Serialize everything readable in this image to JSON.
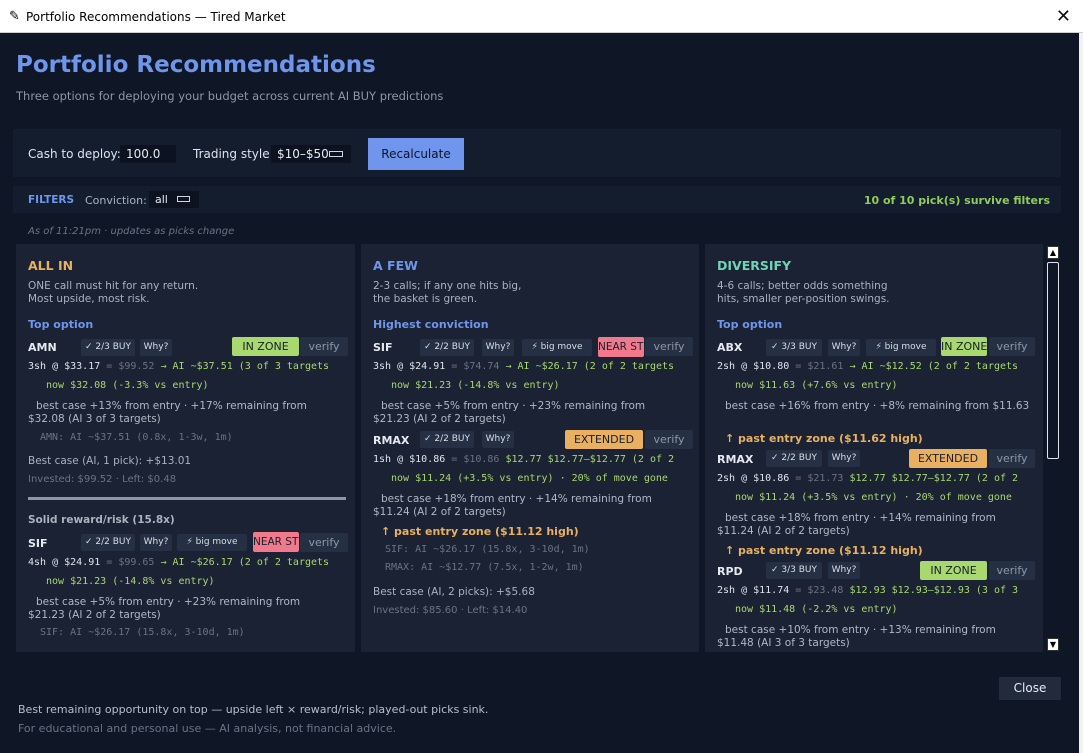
{
  "window": {
    "title": "Portfolio Recommendations — Tired Market"
  },
  "header": {
    "title": "Portfolio Recommendations",
    "subtitle": "Three options for deploying your budget across current AI BUY predictions"
  },
  "controls": {
    "cash_label": "Cash to deploy: $",
    "cash_value": "100.0",
    "style_label": "Trading style:",
    "style_value": "$10–$50",
    "recalc_label": "Recalculate"
  },
  "filters": {
    "label": "FILTERS",
    "conviction_label": "Conviction:",
    "conviction_value": "all",
    "survive_text": "10 of 10 pick(s) survive filters"
  },
  "as_of": "As of 11:21pm · updates as picks change",
  "allin": {
    "title": "ALL IN",
    "desc": "ONE call must hit for any return.\nMost upside, most risk.",
    "top_label": "Top option",
    "pick1": {
      "ticker": "AMN",
      "buy": "✓ 2/3 BUY",
      "why": "Why?",
      "status": "IN ZONE",
      "verify": "verify",
      "l1a": "3sh @ $33.17",
      "l1b": "= $99.52",
      "l1c": "→ AI ~$37.51  (3 of 3 targets",
      "l2a": "now $32.08  (-3.3% vs entry)",
      "best": "best case +13% from entry · +17% remaining from $32.08 (AI 3 of 3 targets)",
      "detail": "AMN: AI ~$37.51  (0.8x, 1-3w, 1m)"
    },
    "best_case": "Best case (AI, 1 pick): +$13.01",
    "invested": "Invested: $99.52 · Left: $0.48",
    "solid_label": "Solid reward/risk (15.8x)",
    "pick2": {
      "ticker": "SIF",
      "buy": "✓ 2/2 BUY",
      "why": "Why?",
      "big": "⚡ big move",
      "near": "NEAR STOP",
      "verify": "verify",
      "l1a": "4sh @ $24.91",
      "l1b": "= $99.65",
      "l1c": "→ AI ~$26.17  (2 of 2 targets",
      "l2a": "now $21.23  (-14.8% vs entry)",
      "best": "best case +5% from entry · +23% remaining from $21.23 (AI 2 of 2 targets)",
      "detail": "SIF: AI ~$26.17  (15.8x, 3-10d, 1m)"
    }
  },
  "afew": {
    "title": "A FEW",
    "desc": "2-3 calls; if any one hits big,\nthe basket is green.",
    "top_label": "Highest conviction",
    "pick1": {
      "ticker": "SIF",
      "buy": "✓ 2/2 BUY",
      "why": "Why?",
      "big": "⚡ big move",
      "near": "NEAR STOP",
      "verify": "verify",
      "l1a": "3sh @ $24.91",
      "l1b": "= $74.74",
      "l1c": "→ AI ~$26.17  (2 of 2 targets",
      "l2a": "now $21.23  (-14.8% vs entry)",
      "best": "best case +5% from entry · +23% remaining from $21.23 (AI 2 of 2 targets)"
    },
    "pick2": {
      "ticker": "RMAX",
      "buy": "✓ 2/2 BUY",
      "why": "Why?",
      "status": "EXTENDED",
      "verify": "verify",
      "l1a": "1sh @ $10.86",
      "l1b": "= $10.86",
      "l1c": "$12.77  $12.77–$12.77  (2 of 2",
      "l2a": "now $11.24  (+3.5% vs entry)  ·  20% of move gone",
      "best": "best case +18% from entry · +14% remaining from $11.24 (AI 2 of 2 targets)",
      "past": "↑ past entry zone ($11.12 high)"
    },
    "detail1": "SIF: AI ~$26.17  (15.8x, 3-10d, 1m)",
    "detail2": "RMAX: AI ~$12.77  (7.5x, 1-2w, 1m)",
    "best_case": "Best case (AI, 2 picks): +$5.68",
    "invested": "Invested: $85.60 · Left: $14.40"
  },
  "diversify": {
    "title": "DIVERSIFY",
    "desc": "4-6 calls; better odds something\nhits, smaller per-position swings.",
    "top_label": "Top option",
    "pick1": {
      "ticker": "ABX",
      "buy": "✓ 3/3 BUY",
      "why": "Why?",
      "big": "⚡ big move",
      "status": "IN ZONE",
      "verify": "verify",
      "l1a": "2sh @ $10.80",
      "l1b": "= $21.61",
      "l1c": "→ AI ~$12.52  (2 of 2 targets",
      "l2a": "now $11.63  (+7.6% vs entry)",
      "best": "best case +16% from entry · +8% remaining from $11.63",
      "past": "↑ past entry zone ($11.62 high)"
    },
    "pick2": {
      "ticker": "RMAX",
      "buy": "✓ 2/2 BUY",
      "why": "Why?",
      "status": "EXTENDED",
      "verify": "verify",
      "l1a": "2sh @ $10.86",
      "l1b": "= $21.73",
      "l1c": "$12.77  $12.77–$12.77  (2 of 2",
      "l2a": "now $11.24  (+3.5% vs entry)  ·  20% of move gone",
      "best": "best case +18% from entry · +14% remaining from $11.24 (AI 2 of 2 targets)",
      "past": "↑ past entry zone ($11.12 high)"
    },
    "pick3": {
      "ticker": "RPD",
      "buy": "✓ 3/3 BUY",
      "why": "Why?",
      "status": "IN ZONE",
      "verify": "verify",
      "l1a": "2sh @ $11.74",
      "l1b": "= $23.48",
      "l1c": "$12.93  $12.93–$12.93  (3 of 3",
      "l2a": "now $11.48  (-2.2% vs entry)",
      "best": "best case +10% from entry · +13% remaining from $11.48 (AI 3 of 3 targets)"
    }
  },
  "footer": {
    "line1": "Best remaining opportunity on top — upside left × reward/risk; played-out picks sink.",
    "line2": "For educational and personal use — AI analysis, not financial advice.",
    "close_label": "Close"
  },
  "colors": {
    "accent": "#6f96ec",
    "allin": "#e8b060",
    "afew": "#6f96ec",
    "diversify": "#6fd4b8",
    "positive": "#a8d86e",
    "near_stop": "#f07a8c"
  },
  "icons": {
    "app": "feather-icon",
    "close": "close-icon",
    "dropdown": "dropdown-icon",
    "scroll_up": "scroll-up-icon",
    "scroll_down": "scroll-down-icon"
  }
}
